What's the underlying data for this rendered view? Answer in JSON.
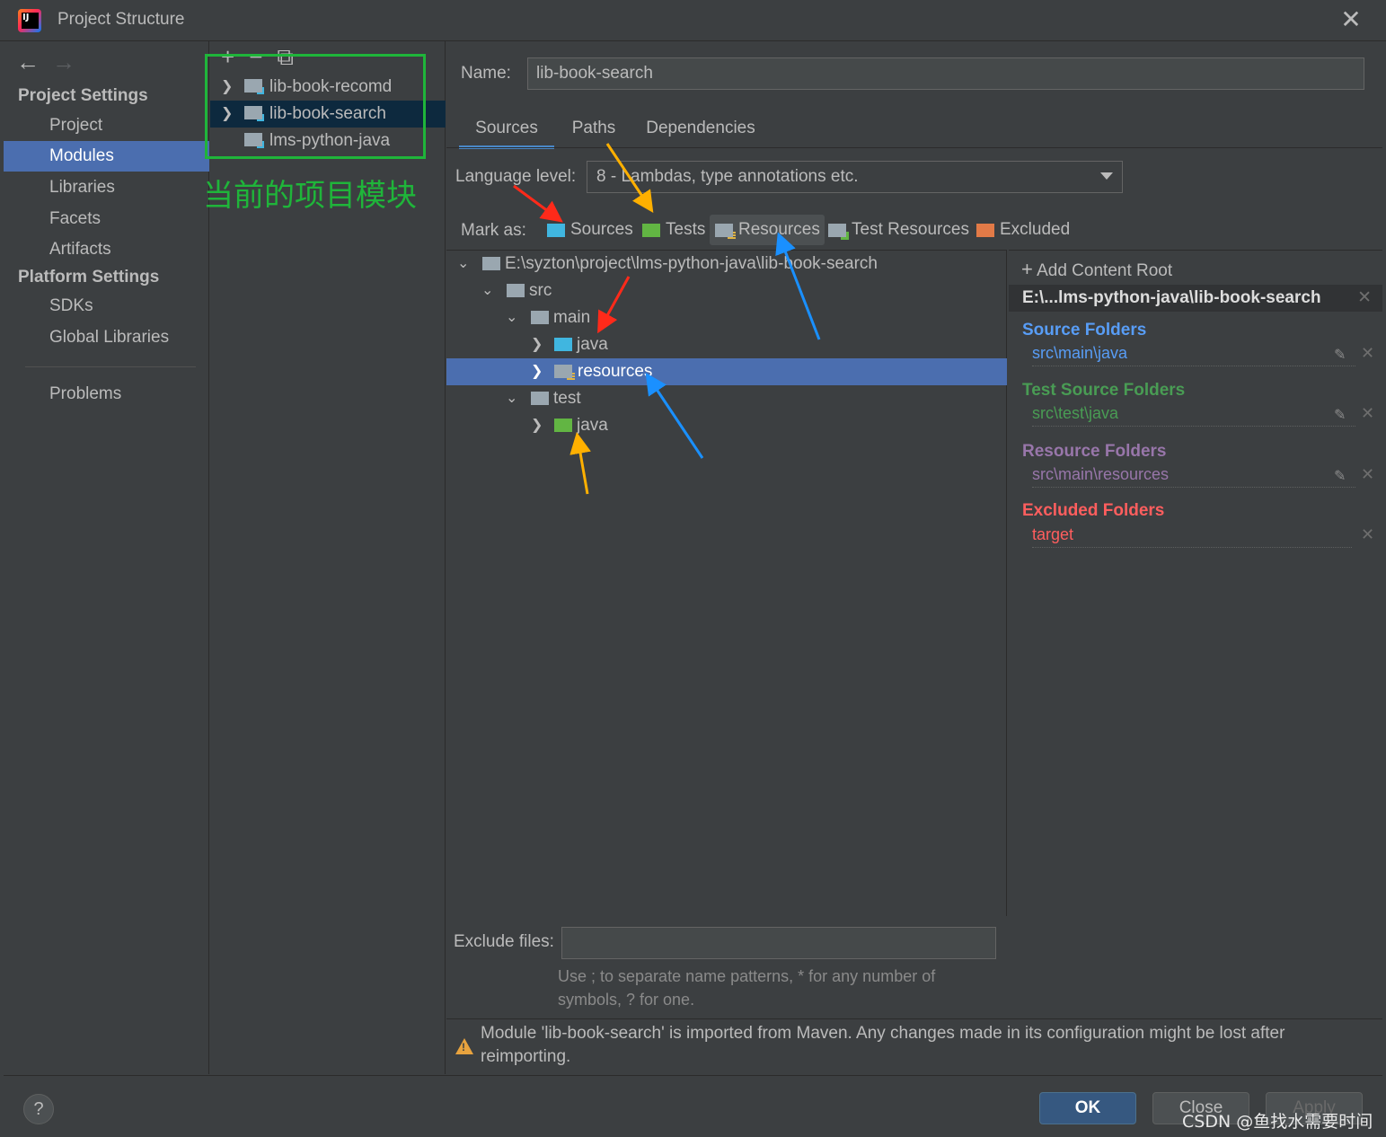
{
  "window": {
    "title": "Project Structure"
  },
  "nav": {
    "project_settings": "Project Settings",
    "project_items": [
      "Project",
      "Modules",
      "Libraries",
      "Facets",
      "Artifacts"
    ],
    "platform_settings": "Platform Settings",
    "platform_items": [
      "SDKs",
      "Global Libraries"
    ],
    "problems": "Problems",
    "selected": "Modules"
  },
  "modules": {
    "items": [
      "lib-book-recomd",
      "lib-book-search",
      "lms-python-java"
    ],
    "selected": "lib-book-search",
    "annotation": "当前的项目模块"
  },
  "main": {
    "name_label": "Name:",
    "name_value": "lib-book-search",
    "tabs": [
      "Sources",
      "Paths",
      "Dependencies"
    ],
    "active_tab": "Sources",
    "language_level_label": "Language level:",
    "language_level_value": "8 - Lambdas, type annotations etc.",
    "mark_as_label": "Mark as:",
    "mark_as": [
      "Sources",
      "Tests",
      "Resources",
      "Test Resources",
      "Excluded"
    ]
  },
  "tree": {
    "root": "E:\\syzton\\project\\lms-python-java\\lib-book-search",
    "src": "src",
    "main": "main",
    "main_java": "java",
    "resources": "resources",
    "test": "test",
    "test_java": "java"
  },
  "roots": {
    "add_content_root": "Add Content Root",
    "content_root": "E:\\...lms-python-java\\lib-book-search",
    "source_title": "Source Folders",
    "source_path": "src\\main\\java",
    "test_title": "Test Source Folders",
    "test_path": "src\\test\\java",
    "resource_title": "Resource Folders",
    "resource_path": "src\\main\\resources",
    "excluded_title": "Excluded Folders",
    "excluded_path": "target"
  },
  "exclude": {
    "label": "Exclude files:",
    "hint": "Use ; to separate name patterns, * for any number of symbols, ? for one."
  },
  "warning": "Module 'lib-book-search' is imported from Maven. Any changes made in its configuration might be lost after reimporting.",
  "footer": {
    "help": "?",
    "ok": "OK",
    "close": "Close",
    "apply": "Apply"
  },
  "watermark": "CSDN @鱼找水需要时间",
  "colors": {
    "source": "#589df6",
    "test": "#499c54",
    "resource": "#9876aa",
    "excluded": "#ff5e5e",
    "selection": "#4b6eaf",
    "annotation": "#1fb53a"
  }
}
